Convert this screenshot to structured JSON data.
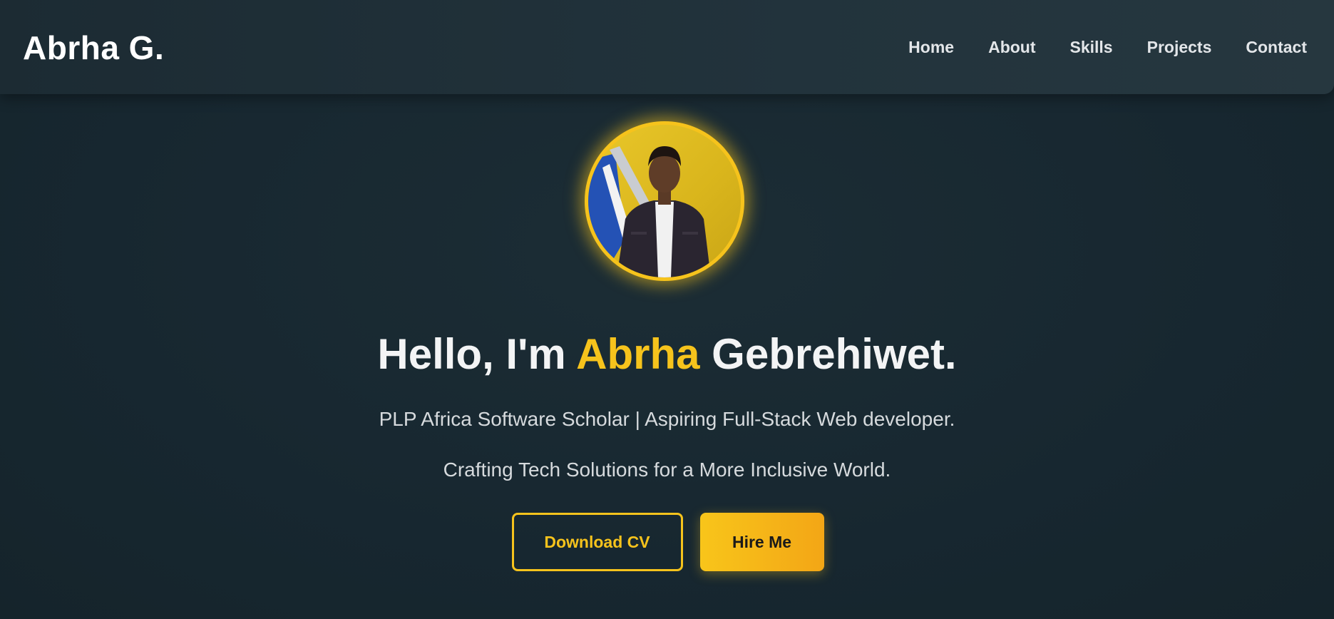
{
  "brand": "Abrha G.",
  "nav": {
    "items": [
      {
        "label": "Home"
      },
      {
        "label": "About"
      },
      {
        "label": "Skills"
      },
      {
        "label": "Projects"
      },
      {
        "label": "Contact"
      }
    ]
  },
  "hero": {
    "greeting_prefix": "Hello, I'm ",
    "greeting_name": "Abrha",
    "greeting_suffix": " Gebrehiwet.",
    "subtitle_1": "PLP Africa Software Scholar | Aspiring Full-Stack Web developer.",
    "subtitle_2": "Crafting Tech Solutions for a More Inclusive World.",
    "download_label": "Download CV",
    "hire_label": "Hire Me"
  },
  "colors": {
    "accent": "#f6c31c",
    "background": "#182830",
    "navbar": "#22333c"
  }
}
